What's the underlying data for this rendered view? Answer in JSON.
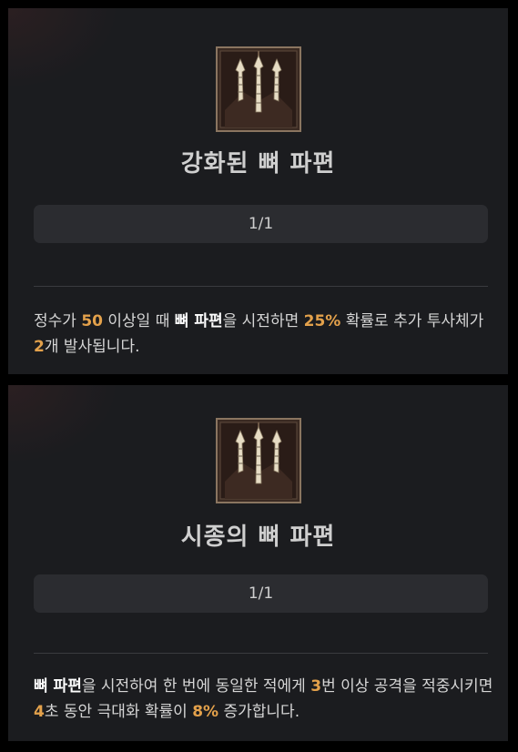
{
  "cards": [
    {
      "icon": "bone-shards-icon",
      "title": "강화된 뼈 파편",
      "stack": "1/1",
      "desc": [
        {
          "t": "정수가 "
        },
        {
          "t": "50",
          "c": "hl"
        },
        {
          "t": " 이상일 때 "
        },
        {
          "t": "뼈 파편",
          "c": "kw"
        },
        {
          "t": "을 시전하면 "
        },
        {
          "t": "25%",
          "c": "hl"
        },
        {
          "t": " 확률로 추가 투사체가 "
        },
        {
          "t": "2",
          "c": "hl"
        },
        {
          "t": "개 발사됩니다."
        }
      ]
    },
    {
      "icon": "bone-shards-icon",
      "title": "시종의 뼈 파편",
      "stack": "1/1",
      "desc": [
        {
          "t": "뼈 파편",
          "c": "kw"
        },
        {
          "t": "을 시전하여 한 번에 동일한 적에게 "
        },
        {
          "t": "3",
          "c": "hl"
        },
        {
          "t": "번 이상 공격을 적중시키면 "
        },
        {
          "t": "4",
          "c": "hl"
        },
        {
          "t": "초 동안 극대화 확률이 "
        },
        {
          "t": "8%",
          "c": "hl"
        },
        {
          "t": " 증가합니다."
        }
      ]
    }
  ],
  "colors": {
    "highlight": "#e3a14b",
    "keyword": "#ffffff",
    "panel": "#1b1c1f"
  }
}
